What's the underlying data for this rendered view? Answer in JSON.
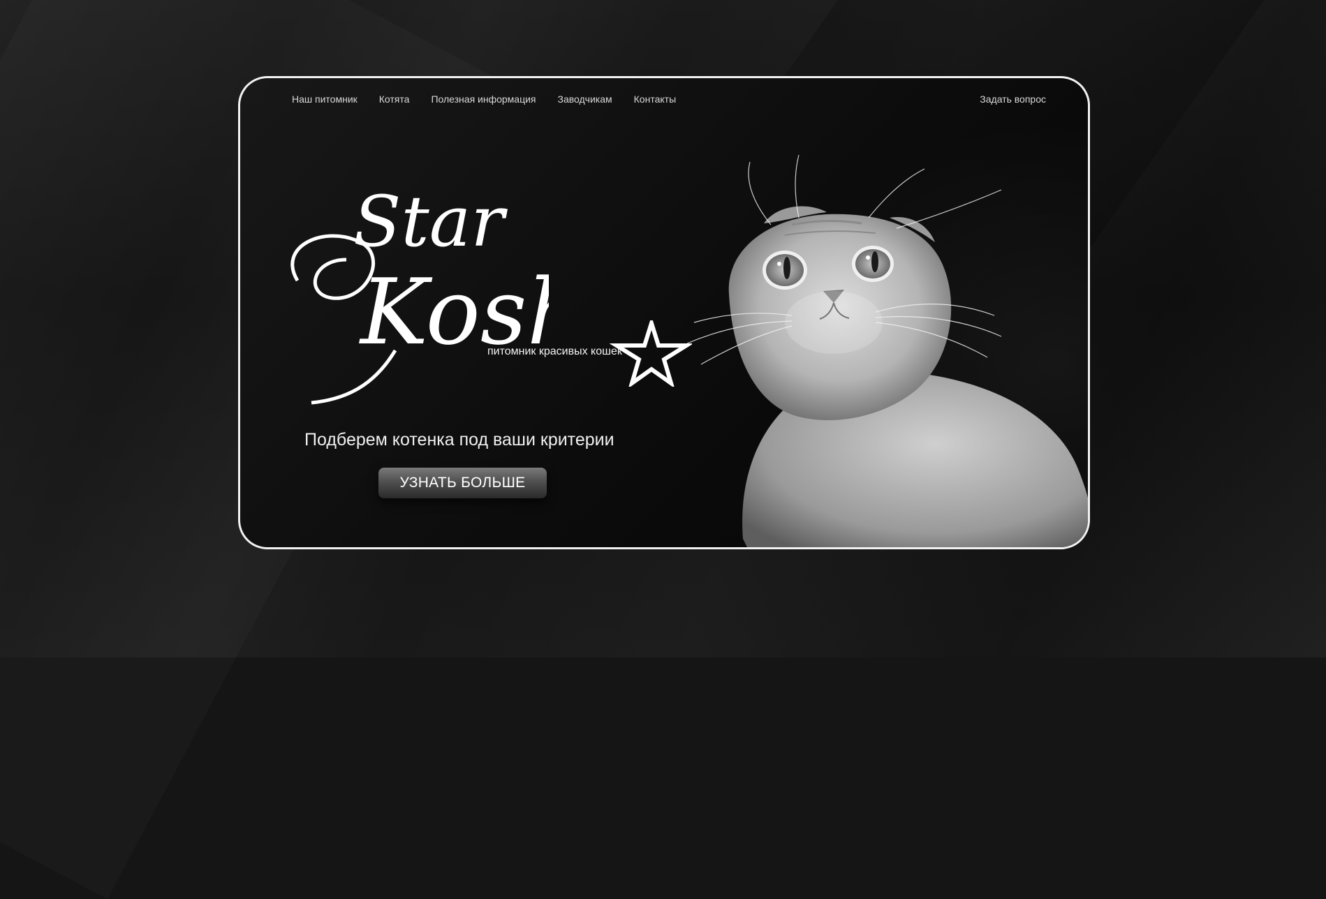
{
  "nav": {
    "items": [
      {
        "label": "Наш питомник"
      },
      {
        "label": "Котята"
      },
      {
        "label": "Полезная информация"
      },
      {
        "label": "Заводчикам"
      },
      {
        "label": "Контакты"
      }
    ],
    "ask_label": "Задать вопрос"
  },
  "logo": {
    "word1": "Star",
    "word2": "Kosh",
    "tagline": "питомник красивых кошек"
  },
  "hero": {
    "headline": "Подберем котенка под ваши критерии",
    "cta_label": "УЗНАТЬ БОЛЬШЕ"
  },
  "colors": {
    "background": "#151515",
    "card_border": "#f2f2f2",
    "text": "#ffffff"
  },
  "icons": {
    "star": "star-outline-icon",
    "cat": "scottish-fold-cat-photo"
  }
}
